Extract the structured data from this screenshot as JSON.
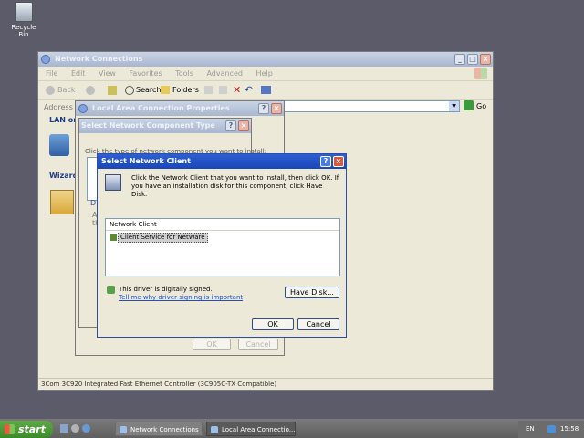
{
  "desktop": {
    "recycle_bin_label": "Recycle Bin"
  },
  "explorer": {
    "title": "Network Connections",
    "menu": [
      "File",
      "Edit",
      "View",
      "Favorites",
      "Tools",
      "Advanced",
      "Help"
    ],
    "toolbar": {
      "back": "Back",
      "search": "Search",
      "folders": "Folders"
    },
    "address_label": "Address",
    "go_label": "Go",
    "sidebar_lan_label": "LAN or H",
    "sidebar_wizard_label": "Wizard",
    "status_text": "3Com 3C920 Integrated Fast Ethernet Controller (3C905C-TX Compatible)"
  },
  "lac_props": {
    "title": "Local Area Connection Properties",
    "ok_label": "OK",
    "cancel_label": "Cancel"
  },
  "component_type": {
    "title": "Select Network Component Type",
    "prompt": "Click the type of network component you want to install:",
    "frag_d": "D",
    "frag_a": "A",
    "frag_th": "th"
  },
  "select_client": {
    "title": "Select Network Client",
    "instructions": "Click the Network Client that you want to install, then click OK. If you have an installation disk for this component, click Have Disk.",
    "list_header": "Network Client",
    "list_items": [
      "Client Service for NetWare"
    ],
    "signed_text": "This driver is digitally signed.",
    "signing_link": "Tell me why driver signing is important",
    "have_disk_label": "Have Disk...",
    "ok_label": "OK",
    "cancel_label": "Cancel"
  },
  "taskbar": {
    "start_label": "start",
    "tasks": [
      "Network Connections",
      "Local Area Connectio..."
    ],
    "language": "EN",
    "clock": "15:58"
  }
}
